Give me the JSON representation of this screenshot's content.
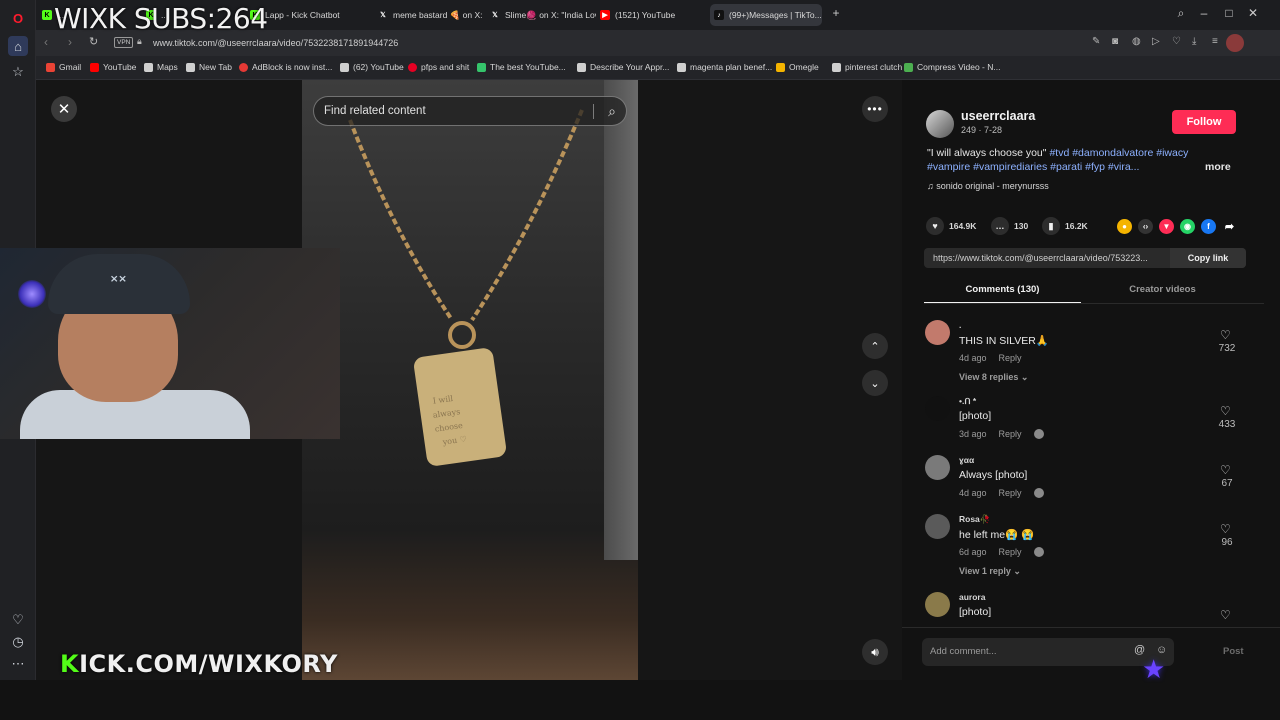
{
  "browser": {
    "tabs": [
      {
        "label": "...",
        "color": "#53fc18",
        "fav": "K"
      },
      {
        "label": "...",
        "color": "#53fc18",
        "fav": "K"
      },
      {
        "label": "Lapp - Kick Chatbot",
        "color": "#53fc18",
        "fav": "K"
      },
      {
        "label": "meme bastard 🍕 on X: \"I...",
        "color": "#222222",
        "fav": "X"
      },
      {
        "label": "Slime🧶 on X: \"India Love...",
        "color": "#222222",
        "fav": "X"
      },
      {
        "label": "(1521) YouTube",
        "color": "#ff0000",
        "fav": "▶"
      },
      {
        "label": "(99+)Messages | TikTo...",
        "color": "#111111",
        "fav": "♪",
        "active": true
      }
    ],
    "url": "www.tiktok.com/@useerrclaara/video/7532238171891944726",
    "vpn_label": "VPN",
    "bookmarks": [
      {
        "label": "Gmail",
        "color": "#ea4335"
      },
      {
        "label": "YouTube",
        "color": "#ff0000"
      },
      {
        "label": "Maps",
        "color": "#cfcfcf"
      },
      {
        "label": "New Tab",
        "color": "#cfcfcf"
      },
      {
        "label": "AdBlock is now inst...",
        "color": "#e53935"
      },
      {
        "label": "(62) YouTube",
        "color": "#cfcfcf"
      },
      {
        "label": "pfps and shit",
        "color": "#e60023"
      },
      {
        "label": "The best YouTube...",
        "color": "#35c46b"
      },
      {
        "label": "Describe Your Appr...",
        "color": "#cfcfcf"
      },
      {
        "label": "magenta plan benef...",
        "color": "#cfcfcf"
      },
      {
        "label": "Omegle",
        "color": "#f4b400"
      },
      {
        "label": "pinterest clutch",
        "color": "#cfcfcf"
      },
      {
        "label": "Compress Video - N...",
        "color": "#4caf50"
      }
    ]
  },
  "overlay": {
    "title": "WIXK SUBS:264",
    "kick_k": "K",
    "kick_rest": "ICK.COM/WIXKORY"
  },
  "video": {
    "search_placeholder": "Find related content"
  },
  "post": {
    "username": "useerrclaara",
    "meta": "249 · 7-28",
    "follow_label": "Follow",
    "caption_quote": "\"I will always choose you\"",
    "tags_line1": "#tvd #damondalvatore #iwacy",
    "tags_line2": "#vampire #vampirediaries #parati #fyp #vira...",
    "more_label": "more",
    "sound": "sonido original - merynursss",
    "likes": "164.9K",
    "comments_count": "130",
    "saves": "16.2K",
    "link": "https://www.tiktok.com/@useerrclaara/video/753223...",
    "copy_label": "Copy link",
    "tab_comments": "Comments (130)",
    "tab_creator": "Creator videos"
  },
  "comments": [
    {
      "name": ".",
      "text": "THIS IN SILVER🙏",
      "age": "4d ago",
      "reply": "Reply",
      "likes": "732",
      "view": "View 8 replies ⌄",
      "avatar_color": "#c27a6c"
    },
    {
      "name": "•.ᑎ *",
      "text": "[photo]",
      "age": "3d ago",
      "reply": "Reply",
      "likes": "433",
      "view": "",
      "avatar_color": "#111111"
    },
    {
      "name": "ɣαα",
      "text": "Always [photo]",
      "age": "4d ago",
      "reply": "Reply",
      "likes": "67",
      "view": "",
      "avatar_color": "#7a7a7a"
    },
    {
      "name": "Rosa🥀",
      "text": "he left me😭 😭",
      "age": "6d ago",
      "reply": "Reply",
      "likes": "96",
      "view": "View 1 reply ⌄",
      "avatar_color": "#5a5a5a"
    },
    {
      "name": "aurora",
      "text": "[photo]",
      "age": "",
      "reply": "",
      "likes": "",
      "view": "",
      "avatar_color": "#8a7a4a"
    }
  ],
  "composer": {
    "placeholder": "Add comment...",
    "post_label": "Post"
  }
}
